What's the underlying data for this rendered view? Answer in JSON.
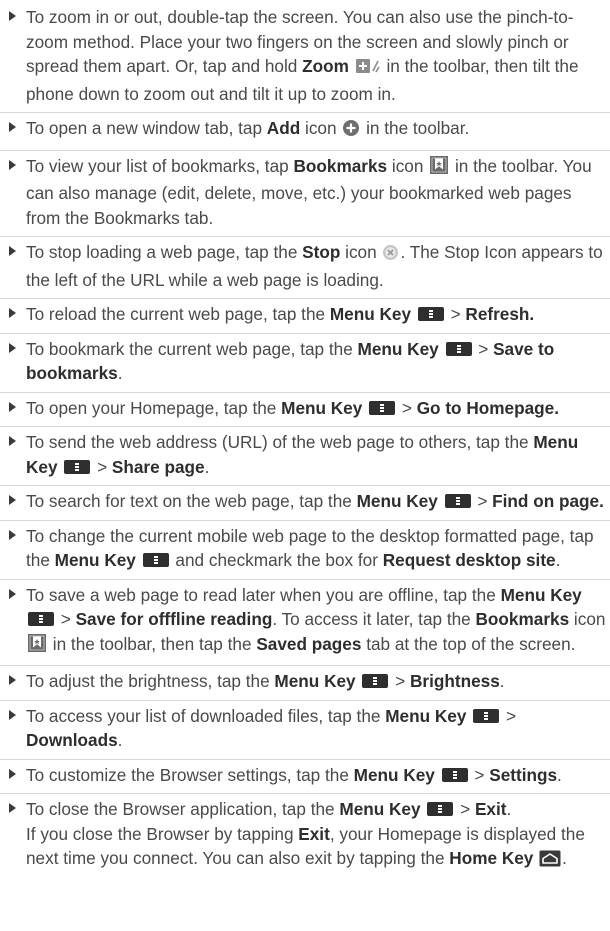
{
  "items": [
    {
      "t1": "To zoom in or out, double-tap the screen. You can also use the pinch-to-zoom method. Place your two fingers on the screen and slowly pinch or spread them apart. Or, tap and hold ",
      "b1": "Zoom",
      "t2": " in the toolbar, then tilt the phone down to zoom out and tilt it up to zoom in."
    },
    {
      "t1": "To open a new window tab, tap ",
      "b1": "Add",
      "t2": " icon ",
      "t3": " in the toolbar."
    },
    {
      "t1": "To view your list of bookmarks, tap ",
      "b1": "Bookmarks",
      "t2": " icon ",
      "t3": " in the toolbar. You can also manage (edit, delete, move, etc.) your bookmarked web pages from the Bookmarks tab."
    },
    {
      "t1": "To stop loading a web page, tap the ",
      "b1": "Stop",
      "t2": " icon ",
      "t3": ". The Stop Icon appears to the left of the URL while a web page is loading."
    },
    {
      "t1": "To reload the current web page, tap the ",
      "b1": "Menu Key",
      "t2": " > ",
      "b2": "Refresh."
    },
    {
      "t1": "To bookmark the current web page, tap the ",
      "b1": "Menu Key",
      "t2": " > ",
      "b2": "Save to bookmarks",
      "t3": "."
    },
    {
      "t1": "To open your Homepage, tap the ",
      "b1": "Menu Key",
      "t2": " > ",
      "b2": "Go to Homepage."
    },
    {
      "t1": "To send the web address (URL) of the web page to others, tap the ",
      "b1": "Menu Key",
      "t2": " > ",
      "b2": "Share page",
      "t3": "."
    },
    {
      "t1": "To search for text on the web page, tap the ",
      "b1": "Menu Key",
      "t2": " > ",
      "b2": "Find on page."
    },
    {
      "t1": "To change the current mobile web page to the desktop formatted page, tap the ",
      "b1": "Menu Key",
      "t2": " and checkmark the box for ",
      "b2": "Request desktop site",
      "t3": "."
    },
    {
      "t1": "To save a web page to read later when you are offline, tap the ",
      "b1": "Menu Key",
      "t2": " > ",
      "b2": "Save for offfline reading",
      "t3": ". To access it later, tap the ",
      "b3": "Bookmarks",
      "t4": " icon ",
      "t5": " in the toolbar, then tap the ",
      "b4": "Saved pages",
      "t6": " tab at the top of the screen."
    },
    {
      "t1": "To adjust the brightness, tap the ",
      "b1": "Menu Key",
      "t2": " > ",
      "b2": "Brightness",
      "t3": "."
    },
    {
      "t1": "To access your list of downloaded files, tap the ",
      "b1": "Menu Key",
      "t2": " > ",
      "b2": "Downloads",
      "t3": "."
    },
    {
      "t1": "To customize the Browser settings, tap the ",
      "b1": "Menu Key",
      "t2": " > ",
      "b2": "Settings",
      "t3": "."
    },
    {
      "t1": "To close the Browser application, tap the ",
      "b1": "Menu Key",
      "t2": " > ",
      "b2": "Exit",
      "t3": ".",
      "t4": "If you close the Browser by tapping ",
      "b3": "Exit",
      "t5": ", your Homepage is displayed the next time you connect. You can also exit by tapping the ",
      "b4": "Home Key",
      "t6": "."
    }
  ]
}
